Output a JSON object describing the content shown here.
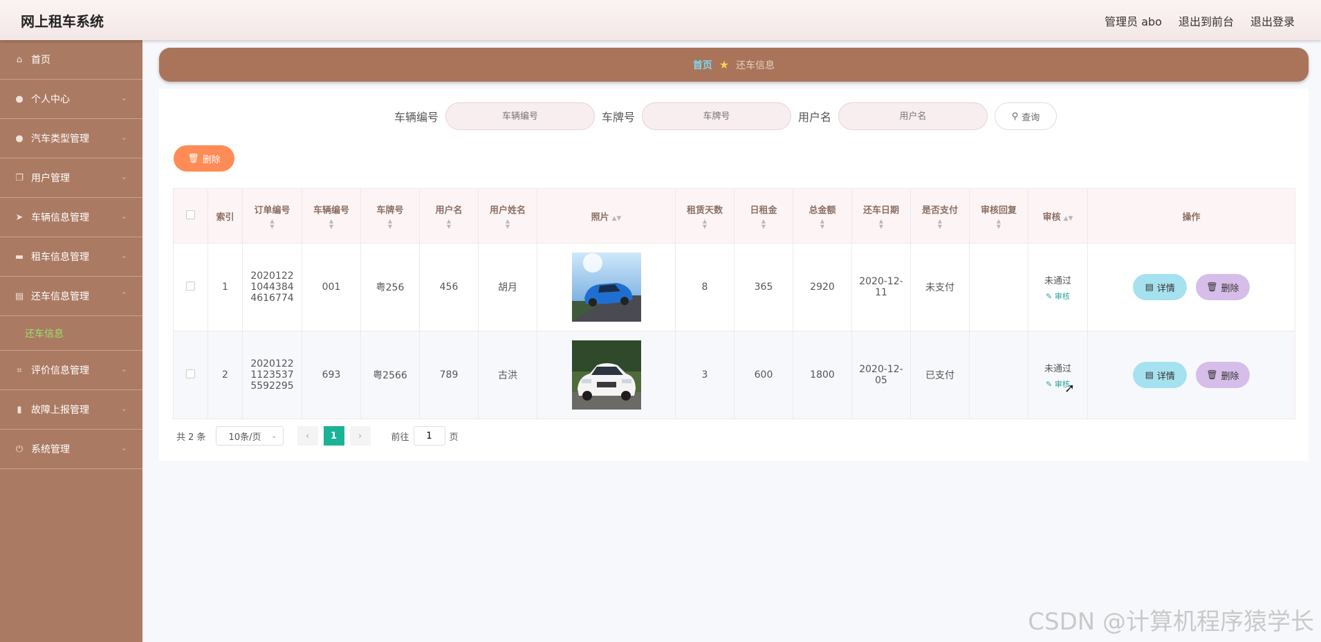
{
  "app": {
    "title": "网上租车系统"
  },
  "topnav": {
    "admin": "管理员 abo",
    "to_front": "退出到前台",
    "logout": "退出登录"
  },
  "sidebar": {
    "items": [
      {
        "label": "首页",
        "icon": "home-icon"
      },
      {
        "label": "个人中心",
        "icon": "user-icon"
      },
      {
        "label": "汽车类型管理",
        "icon": "user-icon"
      },
      {
        "label": "用户管理",
        "icon": "copy-icon"
      },
      {
        "label": "车辆信息管理",
        "icon": "send-icon"
      },
      {
        "label": "租车信息管理",
        "icon": "box-icon"
      },
      {
        "label": "还车信息管理",
        "icon": "clipboard-icon"
      },
      {
        "label": "评价信息管理",
        "icon": "crop-icon"
      },
      {
        "label": "故障上报管理",
        "icon": "chart-icon"
      },
      {
        "label": "系统管理",
        "icon": "power-icon"
      }
    ],
    "active_sub": "还车信息"
  },
  "breadcrumb": {
    "home": "首页",
    "current": "还车信息"
  },
  "search": {
    "vehicle_no_label": "车辆编号",
    "vehicle_no_placeholder": "车辆编号",
    "plate_label": "车牌号",
    "plate_placeholder": "车牌号",
    "username_label": "用户名",
    "username_placeholder": "用户名",
    "query_label": "查询"
  },
  "toolbar": {
    "delete_label": "删除"
  },
  "table": {
    "headers": [
      "索引",
      "订单编号",
      "车辆编号",
      "车牌号",
      "用户名",
      "用户姓名",
      "照片",
      "租赁天数",
      "日租金",
      "总金额",
      "还车日期",
      "是否支付",
      "审核回复",
      "审核",
      "操作"
    ],
    "rows": [
      {
        "index": "1",
        "order_no": "2020122104438446 16774",
        "order_no_lines": [
          "2020122",
          "1044384",
          "4616774"
        ],
        "vehicle_no": "001",
        "plate": "粤256",
        "username": "456",
        "name": "胡月",
        "days": "8",
        "daily": "365",
        "total": "2920",
        "return_date_lines": [
          "2020-12-",
          "11"
        ],
        "paid": "未支付",
        "reply": "",
        "audit": "未通过",
        "audit_link": "审核"
      },
      {
        "index": "2",
        "order_no_lines": [
          "2020122",
          "1123537",
          "5592295"
        ],
        "vehicle_no": "693",
        "plate": "粤2566",
        "username": "789",
        "name": "古洪",
        "days": "3",
        "daily": "600",
        "total": "1800",
        "return_date_lines": [
          "2020-12-",
          "05"
        ],
        "paid": "已支付",
        "reply": "",
        "audit": "未通过",
        "audit_link": "审核"
      }
    ],
    "actions": {
      "detail": "详情",
      "delete": "删除"
    }
  },
  "pager": {
    "total": "共 2 条",
    "page_size": "10条/页",
    "current": "1",
    "goto_label": "前往",
    "goto_value": "1",
    "page_suffix": "页"
  },
  "watermark": "CSDN @计算机程序猿学长",
  "colors": {
    "sidebar": "#ab7a62",
    "breadcrumb": "#a97459",
    "accent": "#1ab394",
    "delete": "#ff8b56"
  }
}
